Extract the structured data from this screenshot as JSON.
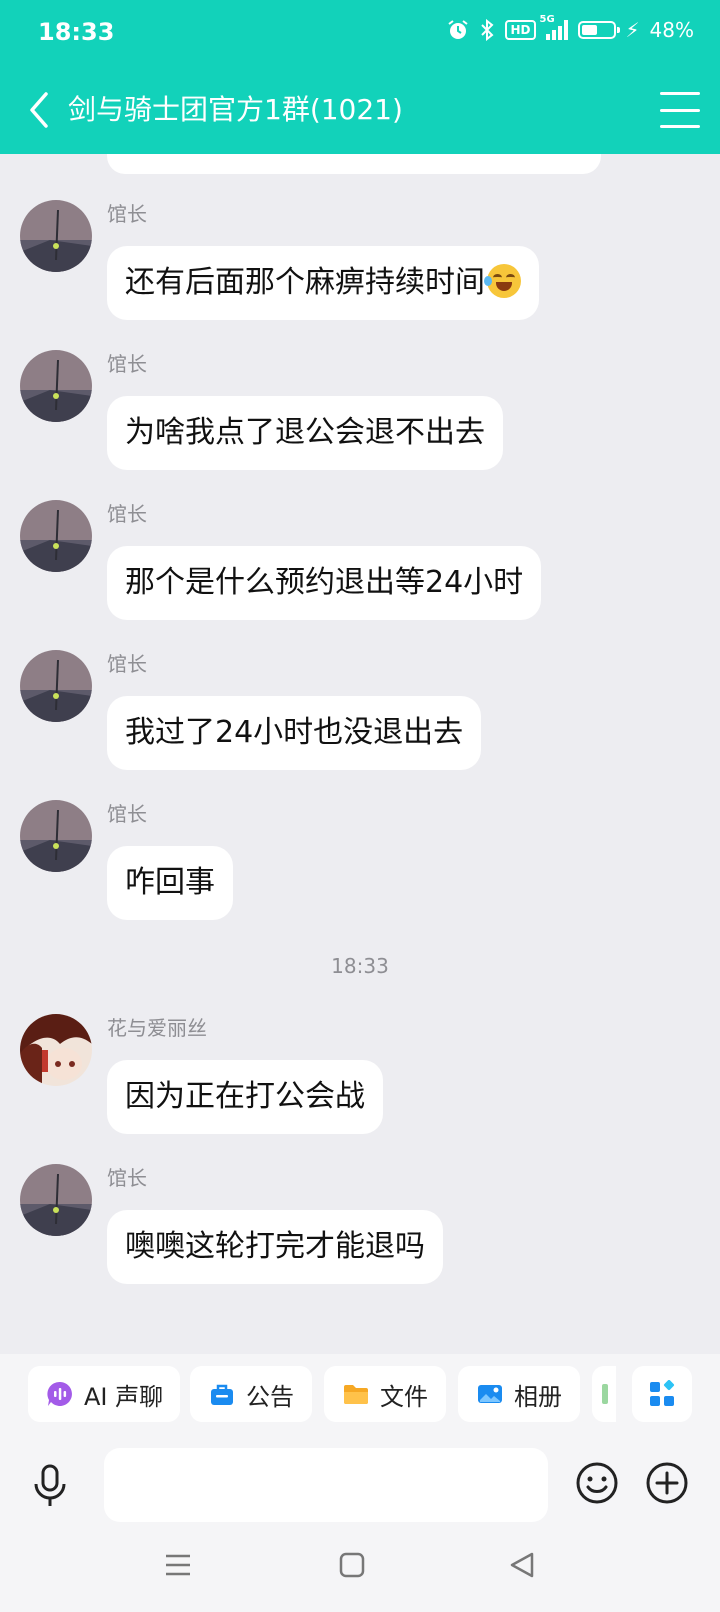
{
  "status": {
    "time": "18:33",
    "hd": "HD",
    "network": "5G",
    "battery": "48%"
  },
  "header": {
    "title": "剑与骑士团官方1群(1021)"
  },
  "messages": [
    {
      "sender": "馆长",
      "text": "还有后面那个麻痹持续时间",
      "emoji": "laughing-crying"
    },
    {
      "sender": "馆长",
      "text": "为啥我点了退公会退不出去"
    },
    {
      "sender": "馆长",
      "text": "那个是什么预约退出等24小时"
    },
    {
      "sender": "馆长",
      "text": "我过了24小时也没退出去"
    },
    {
      "sender": "馆长",
      "text": "咋回事"
    },
    {
      "timestamp": "18:33"
    },
    {
      "sender": "花与爱丽丝",
      "text": "因为正在打公会战"
    },
    {
      "sender": "馆长",
      "text": "噢噢这轮打完才能退吗"
    }
  ],
  "toolbar": {
    "chips": [
      {
        "label": "AI 声聊",
        "icon": "ai-voice-icon"
      },
      {
        "label": "公告",
        "icon": "announcement-icon"
      },
      {
        "label": "文件",
        "icon": "folder-icon"
      },
      {
        "label": "相册",
        "icon": "album-icon"
      }
    ]
  },
  "input": {
    "value": "",
    "placeholder": ""
  },
  "colors": {
    "accent": "#12D2BA",
    "chat_bg": "#EDEDF1"
  }
}
